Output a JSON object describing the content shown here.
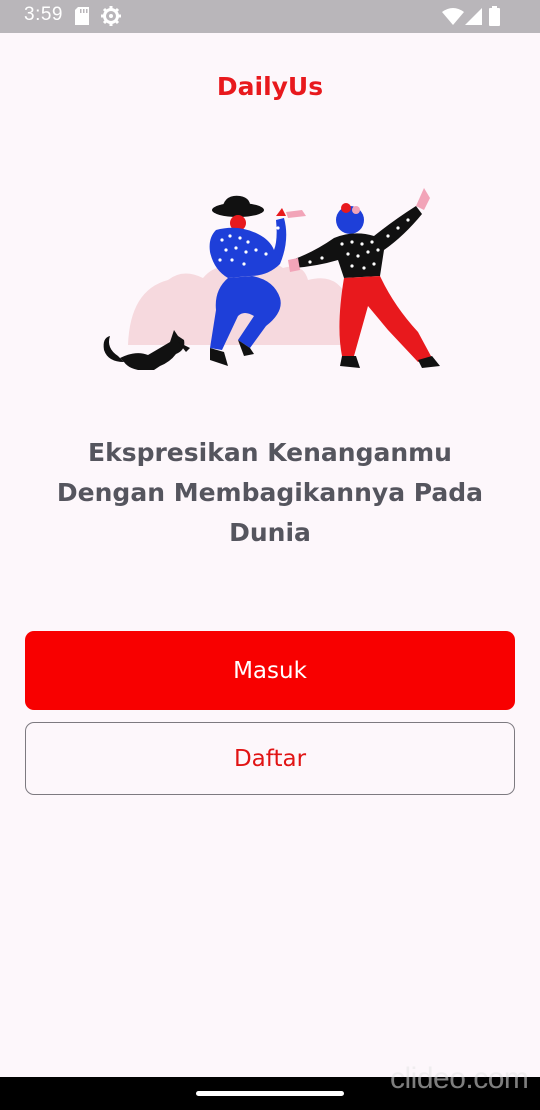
{
  "status_bar": {
    "time": "3:59",
    "icons": [
      "sd-card-icon",
      "settings-gear-icon",
      "wifi-icon",
      "signal-icon",
      "battery-icon"
    ]
  },
  "app": {
    "title": "DailyUs",
    "brand_color": "#e8191d"
  },
  "illustration": {
    "description_icon": "dancing-couple-illustration"
  },
  "tagline": {
    "line1": "Ekspresikan Kenanganmu",
    "line2": "Dengan Membagikannya Pada",
    "line3": "Dunia"
  },
  "buttons": {
    "login_label": "Masuk",
    "register_label": "Daftar",
    "primary_color": "#f80000"
  },
  "watermark": {
    "text": "clideo.com"
  }
}
